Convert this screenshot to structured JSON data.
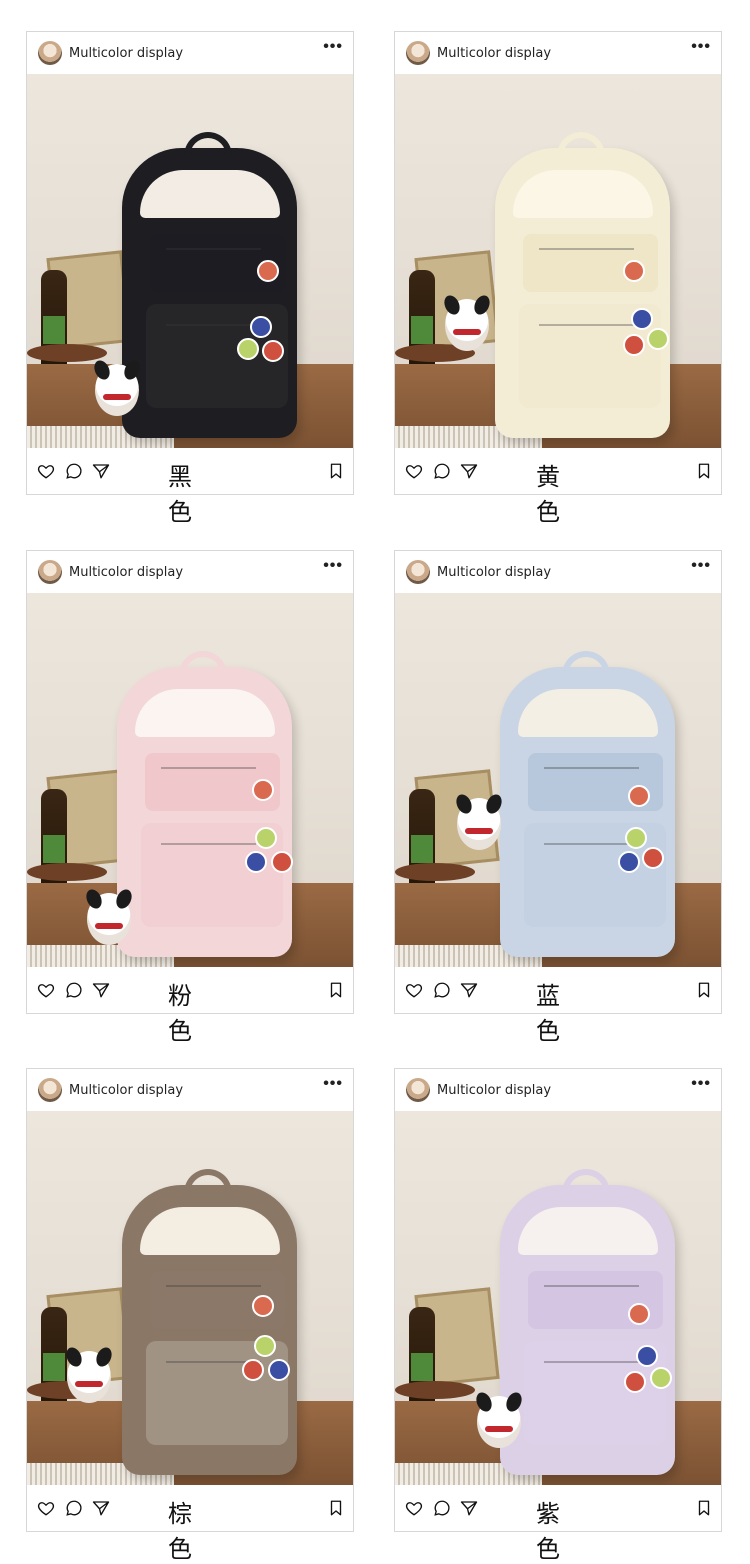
{
  "posts": [
    {
      "username": "Multicolor display",
      "more_label": "•••",
      "color_label": "黑 色",
      "bag_colors": {
        "body": "#1d1d22",
        "top": "#f2ece4",
        "pocket1": "#1c1c22",
        "pocket2": "#262629"
      },
      "photo_alt": "black backpack"
    },
    {
      "username": "Multicolor display",
      "more_label": "•••",
      "color_label": "黄 色",
      "bag_colors": {
        "body": "#f3edd6",
        "top": "#fbf6e6",
        "pocket1": "#efe6c8",
        "pocket2": "#f2ead0"
      },
      "photo_alt": "yellow backpack"
    },
    {
      "username": "Multicolor display",
      "more_label": "•••",
      "color_label": "粉 色",
      "bag_colors": {
        "body": "#f2d6d8",
        "top": "#fbf4f0",
        "pocket1": "#f0c8cc",
        "pocket2": "#f1cfd2"
      },
      "photo_alt": "pink backpack"
    },
    {
      "username": "Multicolor display",
      "more_label": "•••",
      "color_label": "蓝 色",
      "bag_colors": {
        "body": "#c9d5e4",
        "top": "#f4efe5",
        "pocket1": "#b8c8dc",
        "pocket2": "#c3d1e2"
      },
      "photo_alt": "blue backpack"
    },
    {
      "username": "Multicolor display",
      "more_label": "•••",
      "color_label": "棕 色",
      "bag_colors": {
        "body": "#8a7766",
        "top": "#f3ede2",
        "pocket1": "#8b7868",
        "pocket2": "#a09384"
      },
      "photo_alt": "brown backpack"
    },
    {
      "username": "Multicolor display",
      "more_label": "•••",
      "color_label": "紫 色",
      "bag_colors": {
        "body": "#dcd0e6",
        "top": "#f6f1ee",
        "pocket1": "#d4c5e2",
        "pocket2": "#ddd1ea"
      },
      "photo_alt": "purple backpack"
    }
  ],
  "footer_icons": [
    "heart-icon",
    "comment-icon",
    "send-icon",
    "bookmark-icon"
  ]
}
